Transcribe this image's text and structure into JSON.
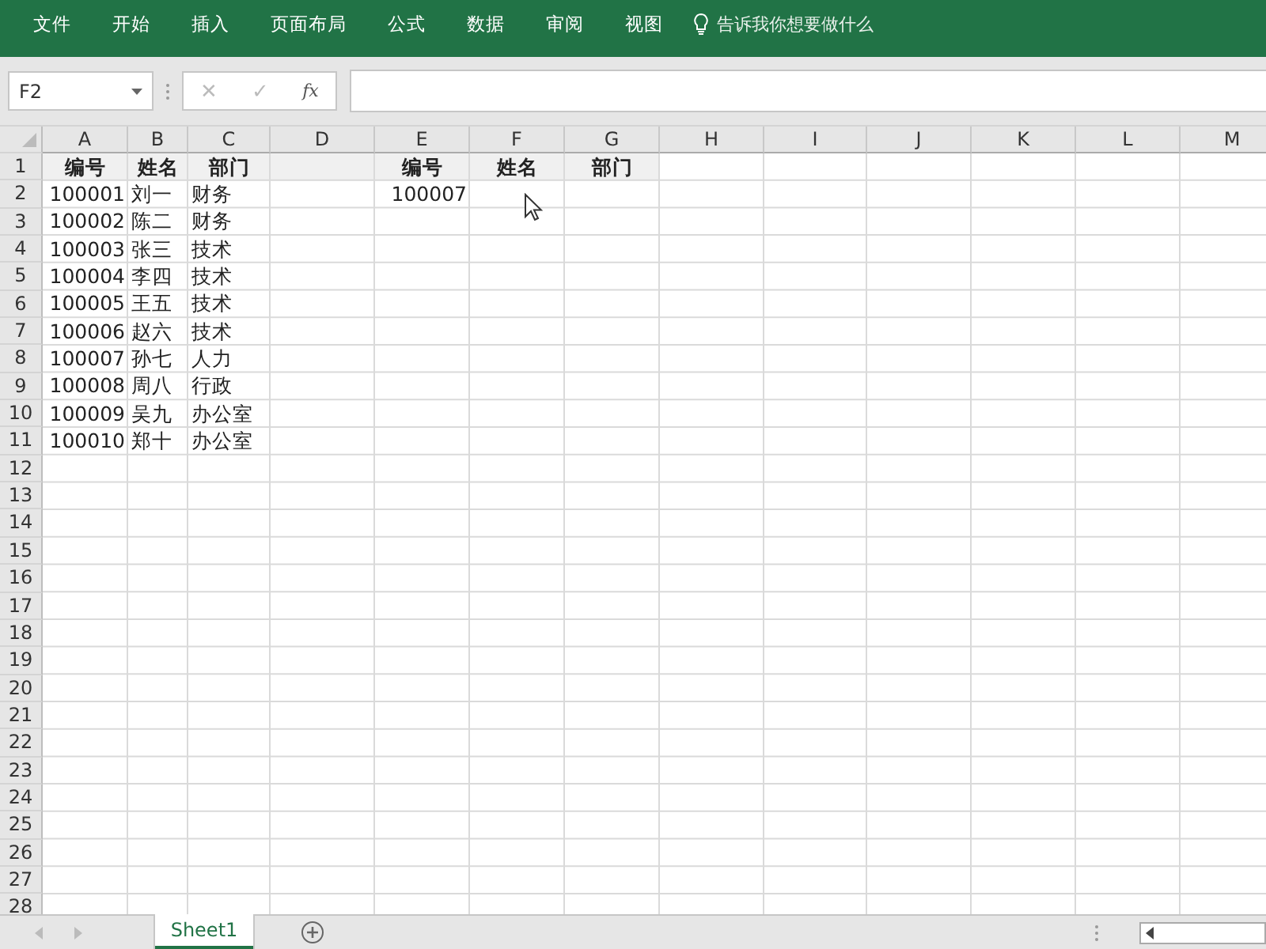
{
  "menu": [
    {
      "label": "文件"
    },
    {
      "label": "开始"
    },
    {
      "label": "插入"
    },
    {
      "label": "页面布局"
    },
    {
      "label": "公式"
    },
    {
      "label": "数据"
    },
    {
      "label": "审阅"
    },
    {
      "label": "视图"
    }
  ],
  "tell_me": {
    "placeholder": "告诉我你想要做什么"
  },
  "name_box": {
    "value": "F2"
  },
  "formula_bar": {
    "cancel": "✕",
    "enter": "✓",
    "fx": "fx"
  },
  "columns": [
    "A",
    "B",
    "C",
    "D",
    "E",
    "F",
    "G",
    "H",
    "I",
    "J",
    "K",
    "L",
    "M"
  ],
  "row_numbers": [
    "1",
    "2",
    "3",
    "4",
    "5",
    "6",
    "7",
    "8",
    "9",
    "10",
    "11",
    "12",
    "13",
    "14",
    "15",
    "16",
    "17",
    "18",
    "19",
    "20",
    "21",
    "22",
    "23",
    "24",
    "25",
    "26",
    "27",
    "28"
  ],
  "source_table": {
    "header": [
      "编号",
      "姓名",
      "部门"
    ],
    "rows": [
      [
        "100001",
        "刘一",
        "财务"
      ],
      [
        "100002",
        "陈二",
        "财务"
      ],
      [
        "100003",
        "张三",
        "技术"
      ],
      [
        "100004",
        "李四",
        "技术"
      ],
      [
        "100005",
        "王五",
        "技术"
      ],
      [
        "100006",
        "赵六",
        "技术"
      ],
      [
        "100007",
        "孙七",
        "人力"
      ],
      [
        "100008",
        "周八",
        "行政"
      ],
      [
        "100009",
        "吴九",
        "办公室"
      ],
      [
        "100010",
        "郑十",
        "办公室"
      ]
    ]
  },
  "lookup_table": {
    "header": [
      "编号",
      "姓名",
      "部门"
    ],
    "rows": [
      [
        "100007"
      ]
    ]
  },
  "sheet_tabs": [
    {
      "label": "Sheet1",
      "selected": true
    }
  ]
}
